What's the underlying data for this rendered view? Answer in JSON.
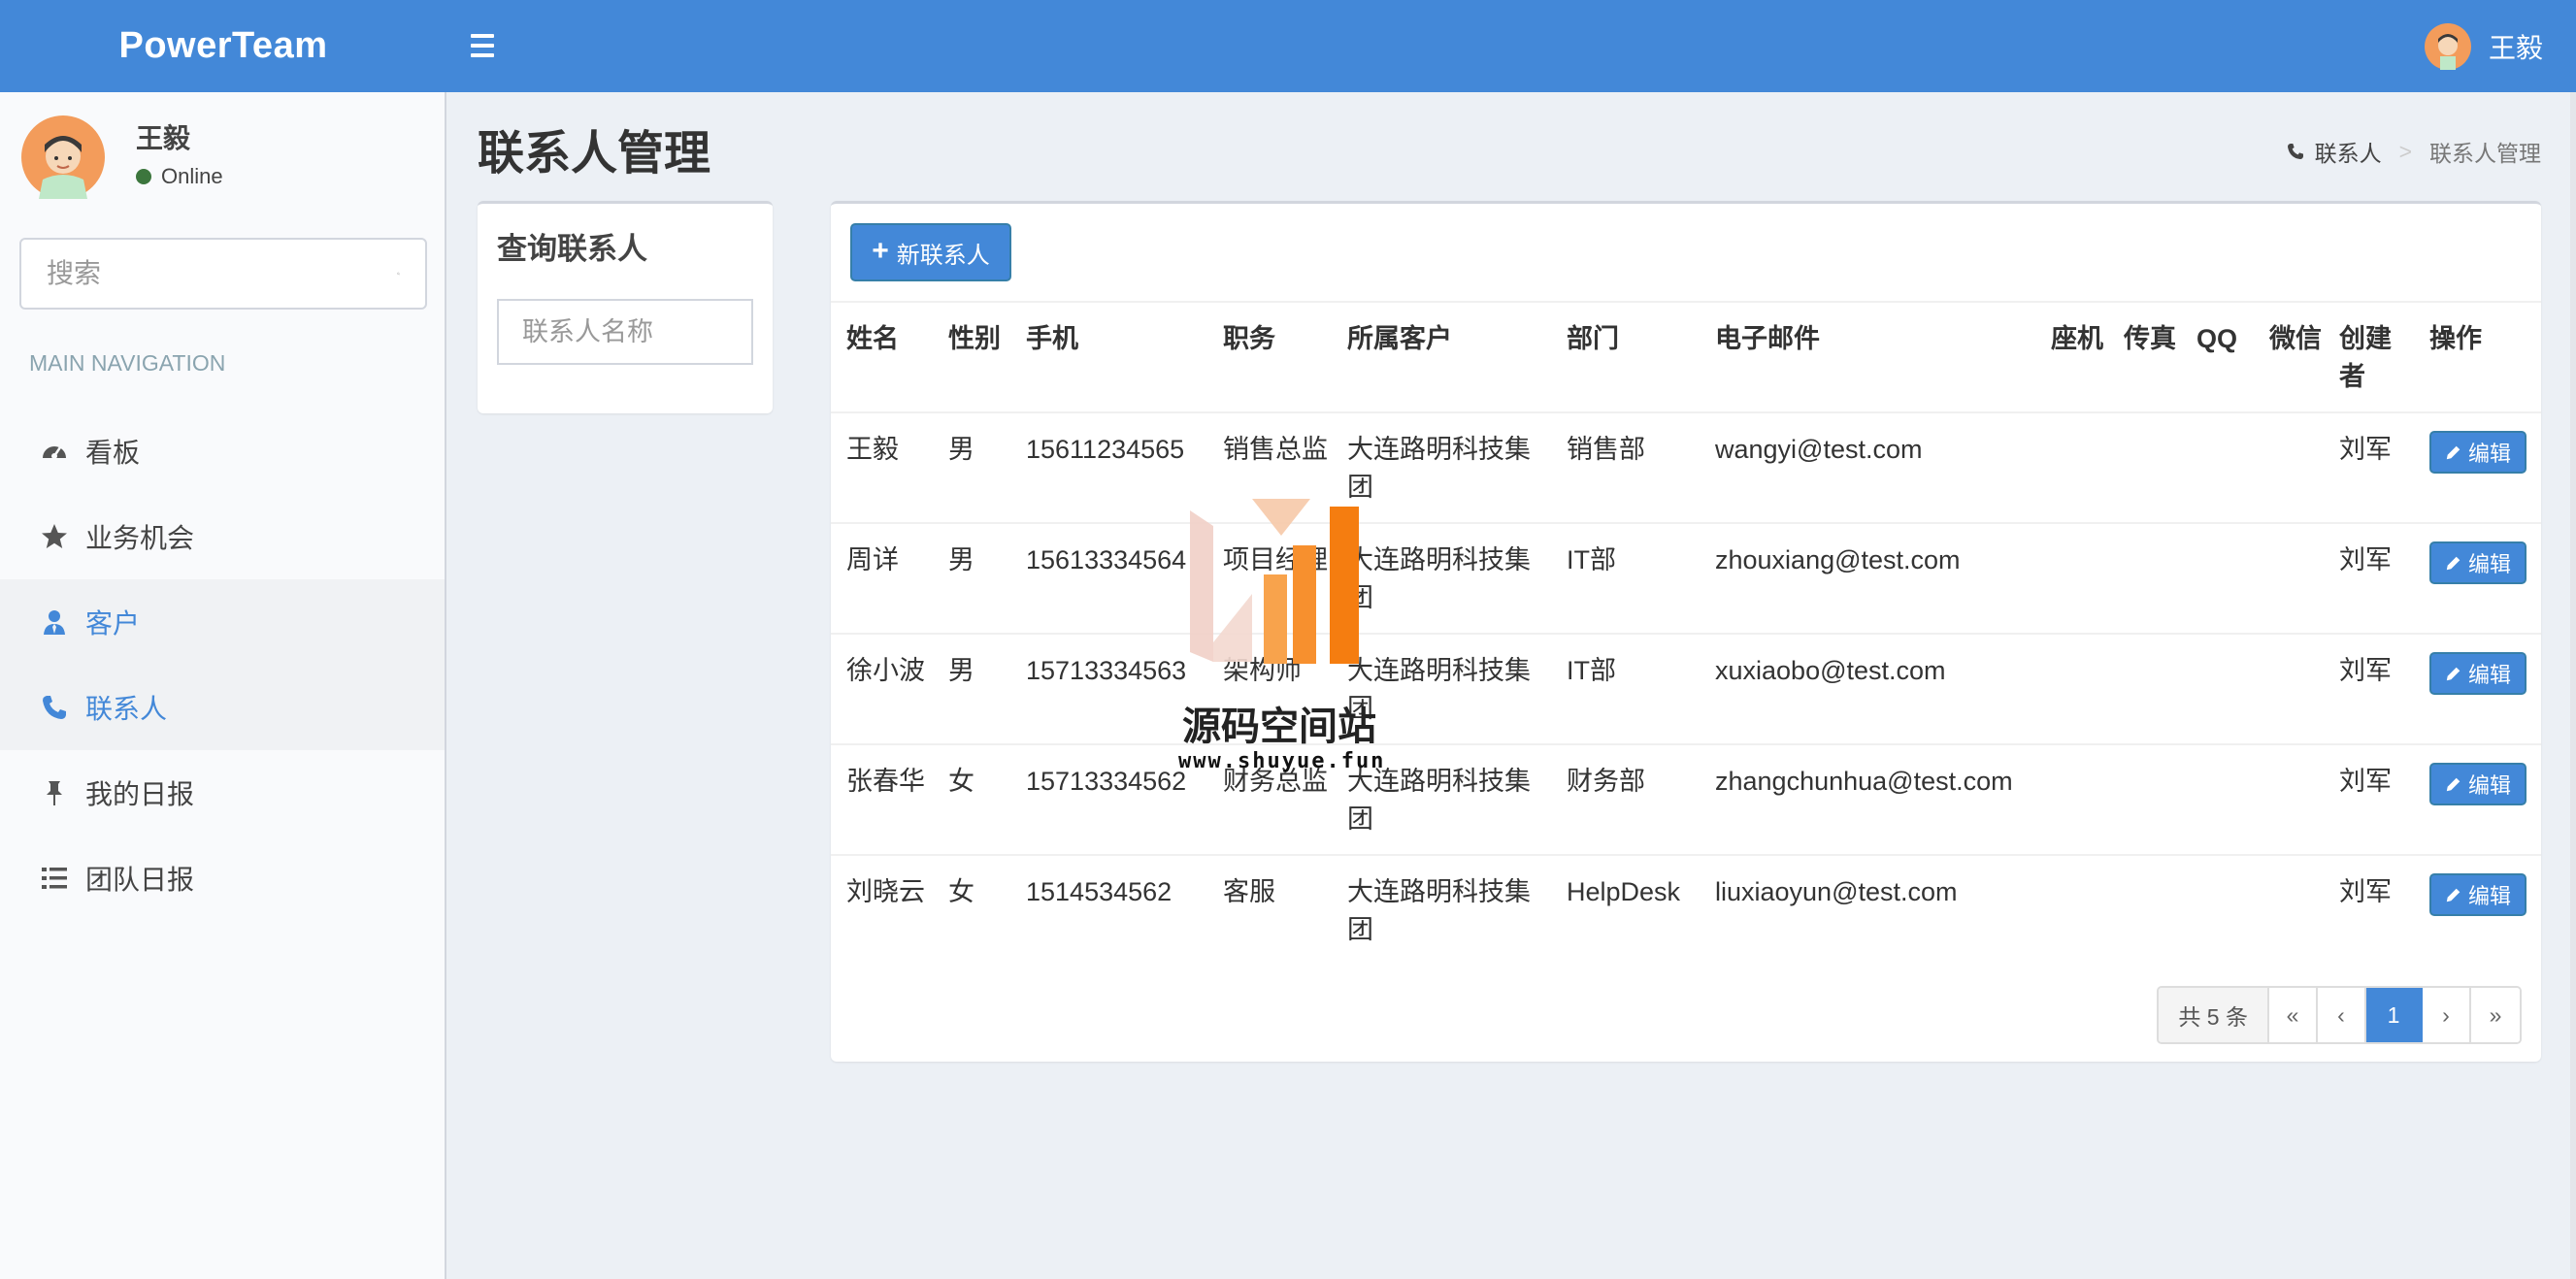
{
  "header": {
    "logo": "PowerTeam",
    "user_name": "王毅",
    "color": "#4388d8"
  },
  "sidebar": {
    "user_name": "王毅",
    "status": "Online",
    "search_placeholder": "搜索",
    "nav_header": "MAIN NAVIGATION",
    "items": [
      {
        "label": "看板",
        "icon": "dashboard-icon"
      },
      {
        "label": "业务机会",
        "icon": "star-icon"
      },
      {
        "label": "客户",
        "icon": "user-tie-icon",
        "active": true
      },
      {
        "label": "联系人",
        "icon": "phone-icon",
        "active": true
      },
      {
        "label": "我的日报",
        "icon": "pin-icon"
      },
      {
        "label": "团队日报",
        "icon": "list-icon"
      }
    ]
  },
  "page": {
    "title": "联系人管理",
    "breadcrumb": [
      "联系人",
      "联系人管理"
    ]
  },
  "query": {
    "title": "查询联系人",
    "placeholder": "联系人名称"
  },
  "table": {
    "new_button": "新联系人",
    "headers": [
      "姓名",
      "性别",
      "手机",
      "职务",
      "所属客户",
      "部门",
      "电子邮件",
      "座机",
      "传真",
      "QQ",
      "微信",
      "创建者",
      "操作"
    ],
    "rows": [
      {
        "name": "王毅",
        "gender": "男",
        "mobile": "15611234565",
        "title": "销售总监",
        "customer": "大连路明科技集团",
        "dept": "销售部",
        "email": "wangyi@test.com",
        "phone": "",
        "fax": "",
        "qq": "",
        "wechat": "",
        "creator": "刘军",
        "action": "编辑"
      },
      {
        "name": "周详",
        "gender": "男",
        "mobile": "15613334564",
        "title": "项目经理",
        "customer": "大连路明科技集团",
        "dept": "IT部",
        "email": "zhouxiang@test.com",
        "phone": "",
        "fax": "",
        "qq": "",
        "wechat": "",
        "creator": "刘军",
        "action": "编辑"
      },
      {
        "name": "徐小波",
        "gender": "男",
        "mobile": "15713334563",
        "title": "架构师",
        "customer": "大连路明科技集团",
        "dept": "IT部",
        "email": "xuxiaobo@test.com",
        "phone": "",
        "fax": "",
        "qq": "",
        "wechat": "",
        "creator": "刘军",
        "action": "编辑"
      },
      {
        "name": "张春华",
        "gender": "女",
        "mobile": "15713334562",
        "title": "财务总监",
        "customer": "大连路明科技集团",
        "dept": "财务部",
        "email": "zhangchunhua@test.com",
        "phone": "",
        "fax": "",
        "qq": "",
        "wechat": "",
        "creator": "刘军",
        "action": "编辑"
      },
      {
        "name": "刘晓云",
        "gender": "女",
        "mobile": "1514534562",
        "title": "客服",
        "customer": "大连路明科技集团",
        "dept": "HelpDesk",
        "email": "liuxiaoyun@test.com",
        "phone": "",
        "fax": "",
        "qq": "",
        "wechat": "",
        "creator": "刘军",
        "action": "编辑"
      }
    ]
  },
  "pagination": {
    "total": "共 5 条",
    "first": "«",
    "prev": "‹",
    "current": "1",
    "next": "›",
    "last": "»"
  },
  "watermark": {
    "text": "源码空间站",
    "url": "www.shuyue.fun"
  }
}
